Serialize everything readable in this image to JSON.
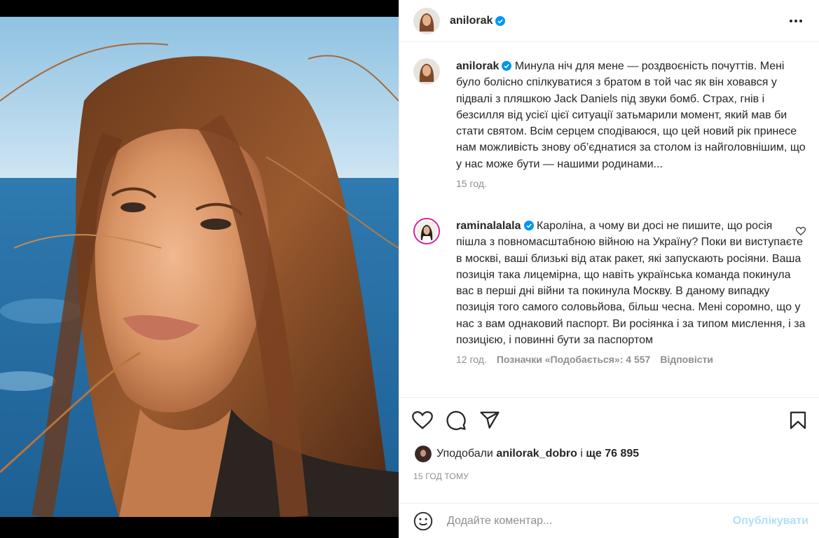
{
  "post": {
    "author": "anilorak"
  },
  "caption": {
    "username": "anilorak",
    "text": "Минула ніч для мене — роздвоєність почуттів. Мені було болісно спілкуватися з братом в той час як він ховався у підвалі з пляшкою Jack Daniels під звуки бомб. Страх, гнів і безсилля від усієї цієї ситуації затьмарили момент, який мав би стати святом. Всім серцем сподіваюся, що цей новий рік принесе нам можливість знову об’єднатися за столом із найголовнішим, що у нас може бути — нашими родинами...",
    "time": "15 год."
  },
  "comments": [
    {
      "username": "raminalalala",
      "text": "Кароліна, а чому ви досі не пишите, що росія пішла з повномасштабною війною на Україну? Поки ви виступаєте в москві, ваші близькі від атак ракет, які запускають росіяни. Ваша позиція така лицемірна, що навіть українська команда покинула вас в перші дні війни та покинула Москву. В даному випадку позиція того самого соловьйова, більш чесна. Мені соромно, що у нас з вам однаковий паспорт. Ви росіянка і за типом мислення, і за позицією, і повинні бути за паспортом",
      "time": "12 год.",
      "likes": "Позначки «Подобається»: 4 557",
      "reply": "Відповісти"
    }
  ],
  "likes": {
    "prefix": "Уподобали",
    "user": "anilorak_dobro",
    "conj": "і",
    "rest": "ще 76 895"
  },
  "timestamp": "15 ГОД ТОМУ",
  "add_comment": {
    "placeholder": "Додайте коментар...",
    "post_label": "Опублікувати"
  },
  "colors": {
    "verified": "#0095f6",
    "muted": "#8e8e8e",
    "post_disabled": "#b2dffc",
    "story_ring": "#d6249f"
  },
  "icons": [
    "verified-badge-icon",
    "more-options-icon",
    "heart-icon",
    "comment-icon",
    "share-icon",
    "bookmark-icon",
    "emoji-icon"
  ]
}
